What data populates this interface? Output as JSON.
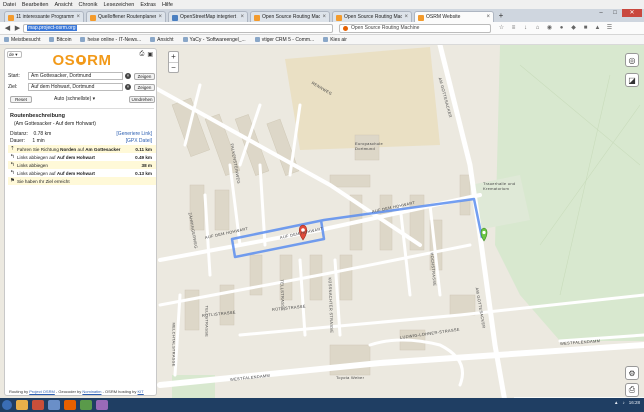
{
  "browser": {
    "menu": [
      "Datei",
      "Bearbeiten",
      "Ansicht",
      "Chronik",
      "Lesezeichen",
      "Extras",
      "Hilfe"
    ],
    "tabs": [
      {
        "label": "11 interessante Programm...",
        "active": false
      },
      {
        "label": "Quelloffener Routenplaner ...",
        "active": false
      },
      {
        "label": "OpenStreetMap integriert ...",
        "active": false
      },
      {
        "label": "Open Source Routing Mac...",
        "active": false
      },
      {
        "label": "Open Source Routing Mac...",
        "active": false
      },
      {
        "label": "OSRM Website",
        "active": true
      }
    ],
    "url": "map.project-osrm.org",
    "search_text": "Open Source Routing Machine",
    "bookmarks": [
      "Meistbesucht",
      "Bitcoin",
      "heise online - IT-News...",
      "Ansicht",
      "YaCy - 'Softwareengel_...",
      "vtiger CRM 5 - Comm...",
      "Kies air"
    ]
  },
  "panel": {
    "lang": "de",
    "start_label": "Start:",
    "start_value": "Am Gottesacker, Dortmund",
    "dest_label": "Ziel:",
    "dest_value": "Auf dem Hohwart, Dortmund",
    "show_label": "Zeigen",
    "reset_label": "Reset",
    "mode_label": "Auto (schnellste)",
    "reverse_label": "Umdrehen",
    "route_title": "Routenbeschreibung",
    "route_subtitle": "(Am Gottesacker - Auf dem Hohwart)",
    "distance_label": "Distanz:",
    "distance_value": "0.78 km",
    "duration_label": "Dauer:",
    "duration_value": "1 min",
    "link_label": "[Generiere Link]",
    "gpx_label": "[GPX Datei]",
    "steps": [
      {
        "icon": "⇡",
        "prefix": "Fahren Sie Richtung ",
        "dir": "Norden",
        "mid": " auf ",
        "street": "Am Gottesacker",
        "dist": "0.11 km"
      },
      {
        "icon": "↰",
        "prefix": "Links abbiegen ",
        "dir": "",
        "mid": "auf ",
        "street": "Auf dem Hohwart",
        "dist": "0.49 km"
      },
      {
        "icon": "↰",
        "prefix": "Links abbiegen",
        "dir": "",
        "mid": "",
        "street": "",
        "dist": "38 m"
      },
      {
        "icon": "↰",
        "prefix": "Links abbiegen ",
        "dir": "",
        "mid": "auf ",
        "street": "Auf dem Hohwart",
        "dist": "0.13 km"
      },
      {
        "icon": "⚑",
        "prefix": "Sie haben Ihr Ziel erreicht",
        "dir": "",
        "mid": "",
        "street": "",
        "dist": ""
      }
    ],
    "footer_prefix": "Routing by ",
    "footer_routing": "Project OSRM",
    "footer_mid": " - Geocoder by ",
    "footer_geocoder": "Nominatim",
    "footer_mid2": " - OSRM hosting by ",
    "footer_host": "KIT"
  },
  "map": {
    "labels": {
      "rennweg": "RENNWEG",
      "am_gottesacker": "AM GOTTESACKER",
      "auf_dem_hohwart_a": "AUF DEM HOHWART",
      "auf_dem_hohwart_b": "AUF DEM HOHWART",
      "auf_dem_hohwart_c": "AUF DEM HOHWART",
      "ludwig_lohner": "LUDWIG-LOHNER-STRASSE",
      "westfalendamm_a": "WESTFALENDAMM",
      "westfalendamm_b": "WESTFALENDAMM",
      "rutlistrasse_a": "RÜTLISTRASSE",
      "rutlistrasse_b": "RÜTLISTRASSE",
      "tellstrasse_a": "TELLSTRASSE",
      "tellstrasse_b": "TELLSTRASSE",
      "melchtalstrasse": "MELCHTALSTRASSE",
      "kussnachter": "KÜSSNACHTER STRASSE",
      "hochstrasse": "HOCHSTRASSE",
      "school": "Europaschule Dortmund",
      "cemetery": "Trauerhalle und Krematorium",
      "dealer": "Toyota Weber",
      "zahringerweg": "ZÄHRINGERWEG",
      "falkensteinweg": "FALKENSTEINWEG"
    },
    "attribution_prefix": "Powered by ",
    "attribution_leaflet": "Leaflet",
    "attribution_rest": " — © Mapbox © OpenStreetMap",
    "attribution_improve": "Improve this map",
    "route_color": "#5b8def",
    "start_marker_color": "#6cc644",
    "end_marker_color": "#e04b3a"
  },
  "taskbar": {
    "clock": "16:28"
  }
}
